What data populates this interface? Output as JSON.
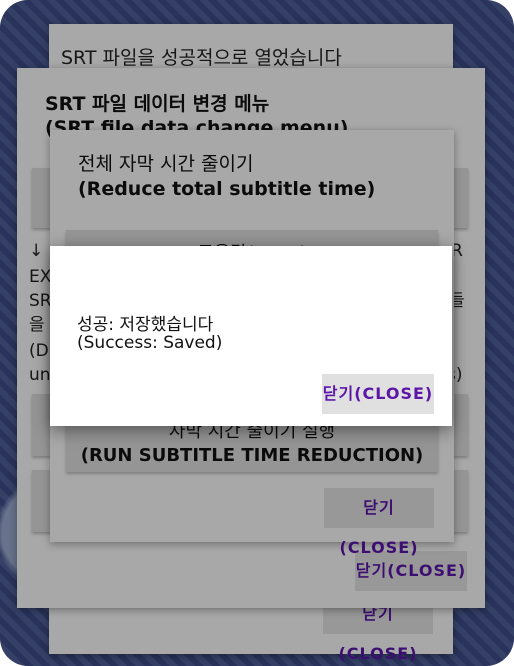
{
  "bottom_dialog": {
    "title": "SRT 파일을 성공적으로 열었습니다",
    "close_label": "닫기(CLOSE)"
  },
  "menu_dialog": {
    "title_ko": "SRT 파일 데이터 변경 메뉴",
    "title_en": "(SRT file data change menu)",
    "left_fragments": [
      "↓",
      "EX",
      "SR",
      "을",
      "(D",
      "un"
    ],
    "right_fragments": [
      "R",
      "들",
      "s)"
    ],
    "close_label": "닫기(CLOSE)"
  },
  "reduce_dialog": {
    "title_ko": "전체 자막 시간 줄이기",
    "title_en": "(Reduce total subtitle time)",
    "help_button": "도움말(HELP)",
    "run_button_ko": "자막 시간 줄이기 실행",
    "run_button_en": "(RUN SUBTITLE TIME REDUCTION)",
    "close_label": "닫기(CLOSE)"
  },
  "success_dialog": {
    "message_ko": "성공: 저장했습니다",
    "message_en": "(Success: Saved)",
    "close_label": "닫기(CLOSE)"
  }
}
